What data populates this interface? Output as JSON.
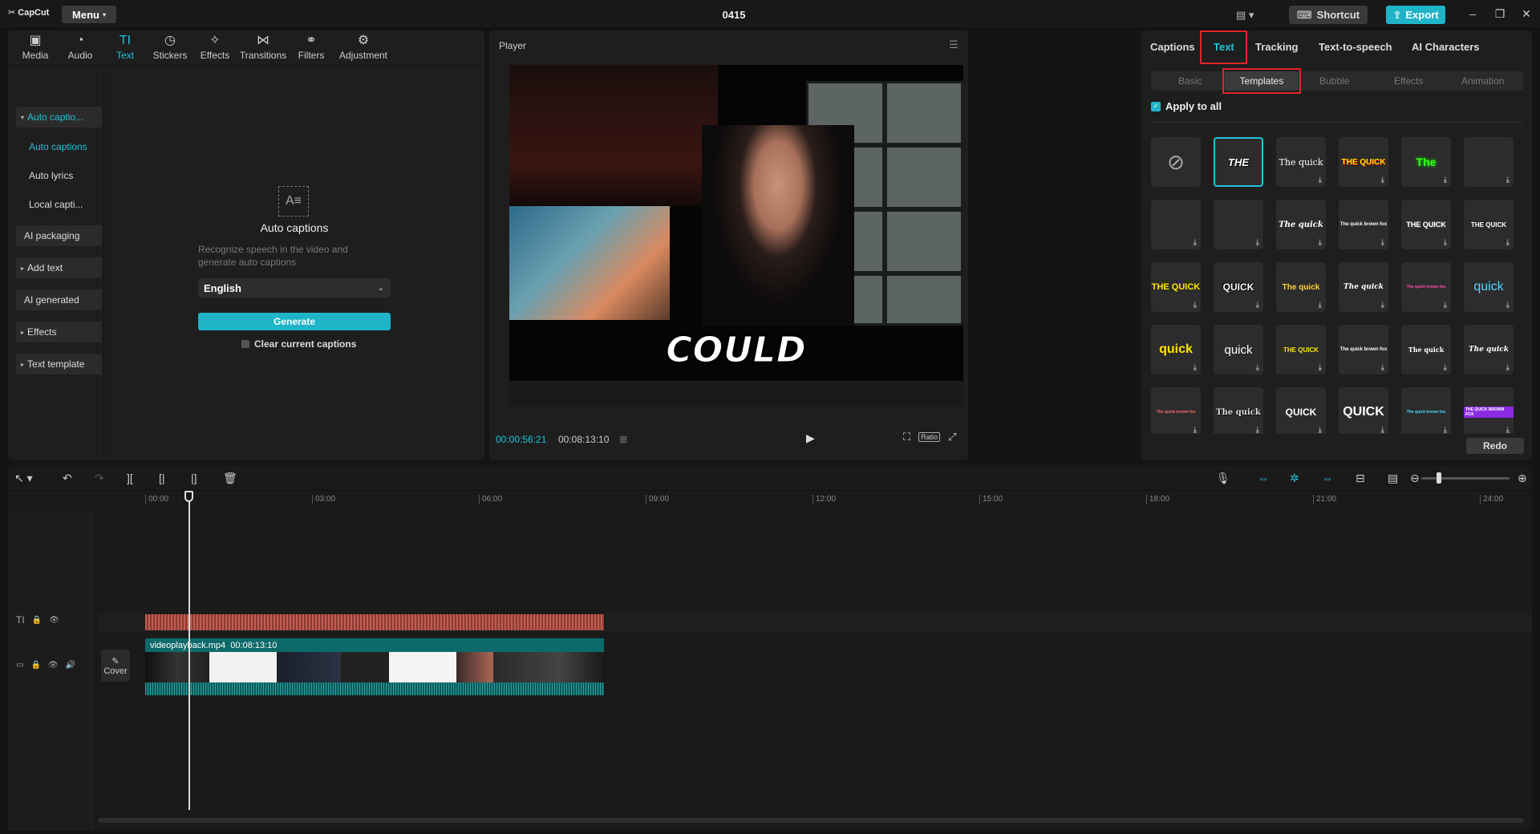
{
  "app": {
    "logo": "CapCut",
    "menu_label": "Menu",
    "project_title": "0415",
    "shortcut_label": "Shortcut",
    "export_label": "Export"
  },
  "toolbar": {
    "tabs": [
      {
        "label": "Media",
        "icon": "media-icon"
      },
      {
        "label": "Audio",
        "icon": "audio-icon"
      },
      {
        "label": "Text",
        "icon": "text-icon"
      },
      {
        "label": "Stickers",
        "icon": "stickers-icon"
      },
      {
        "label": "Effects",
        "icon": "effects-icon"
      },
      {
        "label": "Transitions",
        "icon": "transitions-icon"
      },
      {
        "label": "Filters",
        "icon": "filters-icon"
      },
      {
        "label": "Adjustment",
        "icon": "adjustment-icon"
      }
    ],
    "active": "Text"
  },
  "sidebar": {
    "items": [
      {
        "label": "Auto captio..."
      },
      {
        "label": "Auto captions"
      },
      {
        "label": "Auto lyrics"
      },
      {
        "label": "Local capti..."
      },
      {
        "label": "AI packaging"
      },
      {
        "label": "Add text"
      },
      {
        "label": "AI generated"
      },
      {
        "label": "Effects"
      },
      {
        "label": "Text template"
      }
    ]
  },
  "auto_captions": {
    "title": "Auto captions",
    "description": "Recognize speech in the video and generate auto captions",
    "language": "English",
    "generate_label": "Generate",
    "clear_label": "Clear current captions"
  },
  "player": {
    "label": "Player",
    "caption_text": "COULD",
    "current_time": "00:00:56:21",
    "total_time": "00:08:13:10",
    "ratio_label": "Ratio"
  },
  "right_panel": {
    "tabs": [
      "Captions",
      "Text",
      "Tracking",
      "Text-to-speech",
      "AI Characters"
    ],
    "active_tab": "Text",
    "sub_tabs": [
      "Basic",
      "Templates",
      "Bubble",
      "Effects",
      "Animation"
    ],
    "active_sub_tab": "Templates",
    "apply_all_label": "Apply to all",
    "templates": [
      {
        "text": "",
        "kind": "none"
      },
      {
        "text": "THE",
        "kind": "selected"
      },
      {
        "text": "The quick",
        "kind": "serif"
      },
      {
        "text": "THE QUICK",
        "kind": "yellow-box"
      },
      {
        "text": "The",
        "kind": "green"
      },
      {
        "text": "",
        "kind": "empty"
      },
      {
        "text": "",
        "kind": "empty"
      },
      {
        "text": "",
        "kind": "empty"
      },
      {
        "text": "The quick",
        "kind": "italic"
      },
      {
        "text": "The quick brown fox",
        "kind": "tiny"
      },
      {
        "text": "THE QUICK",
        "kind": "outline"
      },
      {
        "text": "THE QUICK",
        "kind": "plain-small"
      },
      {
        "text": "THE QUICK",
        "kind": "yellow-cond"
      },
      {
        "text": "QUICK",
        "kind": "black-stroke"
      },
      {
        "text": "The quick",
        "kind": "gold"
      },
      {
        "text": "The quick",
        "kind": "italic-serif"
      },
      {
        "text": "The quick brown fox",
        "kind": "pink-tiny"
      },
      {
        "text": "quick",
        "kind": "cyan"
      },
      {
        "text": "quick",
        "kind": "yellow-big"
      },
      {
        "text": "quick",
        "kind": "white-big"
      },
      {
        "text": "THE QUICK",
        "kind": "yellow-small"
      },
      {
        "text": "The quick brown fox",
        "kind": "tiny"
      },
      {
        "text": "The quick",
        "kind": "serif-small"
      },
      {
        "text": "The quick",
        "kind": "italic-serif"
      },
      {
        "text": "The quick brown fox",
        "kind": "red-tiny"
      },
      {
        "text": "The quick",
        "kind": "outline-serif"
      },
      {
        "text": "QUICK",
        "kind": "plain-mid"
      },
      {
        "text": "QUICK",
        "kind": "bold-big"
      },
      {
        "text": "The quick brown fox",
        "kind": "cyan-tiny"
      },
      {
        "text": "THE QUICK BROWN FOX",
        "kind": "purple-box"
      }
    ],
    "redo_label": "Redo"
  },
  "timeline": {
    "ruler": [
      "00:00",
      "03:00",
      "06:00",
      "09:00",
      "12:00",
      "15:00",
      "18:00",
      "21:00",
      "24:00"
    ],
    "clip_name": "videoplayback.mp4",
    "clip_duration": "00:08:13:10",
    "cover_label": "Cover"
  }
}
